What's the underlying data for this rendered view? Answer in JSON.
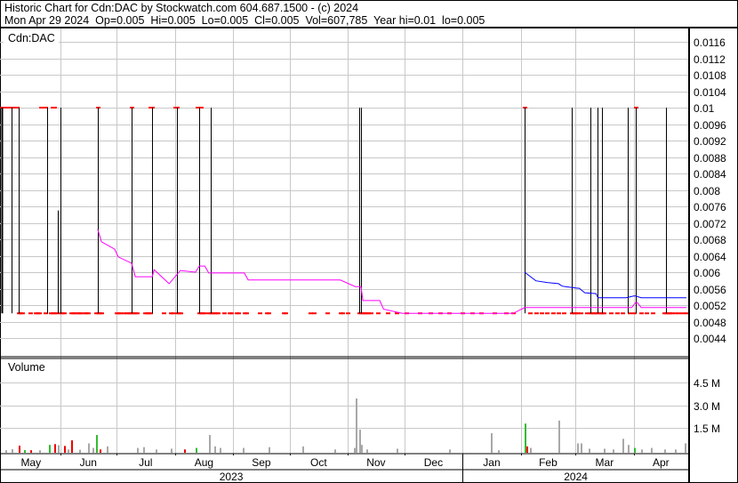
{
  "header": {
    "title": "Historic Chart for Cdn:DAC by Stockwatch.com 604.687.1500 - (c) 2024",
    "quote": "Mon Apr 29 2024  Op=0.005  Hi=0.005  Lo=0.005  Cl=0.005  Vol=607,785  Year hi=0.01  lo=0.005"
  },
  "colors": {
    "grid": "#c8c8c8",
    "bar": "#000000",
    "tick": "#ff0000",
    "ma_short": "#ff00ff",
    "ma_long": "#0000ff",
    "vol_gray": "#a8a8a8",
    "vol_up": "#33bb33",
    "vol_down": "#ee0000"
  },
  "chart_data": [
    {
      "type": "line",
      "title": "Cdn:DAC",
      "x_unit": "days since May 1 2023",
      "xlim": [
        0,
        365
      ],
      "ylim": [
        0.0042,
        0.0118
      ],
      "yticks": [
        "0.0116",
        "0.0112",
        "0.0108",
        "0.0104",
        "0.01",
        "0.0096",
        "0.0092",
        "0.0088",
        "0.0084",
        "0.008",
        "0.0076",
        "0.0072",
        "0.0068",
        "0.0064",
        "0.006",
        "0.0056",
        "0.0052",
        "0.0048",
        "0.0044"
      ],
      "grid": true,
      "hilo_bars": [
        [
          0,
          0.005,
          0.01
        ],
        [
          5,
          0.005,
          0.01
        ],
        [
          9,
          0.005,
          0.01
        ],
        [
          24,
          0.005,
          0.01
        ],
        [
          30,
          0.005,
          0.0075
        ],
        [
          31,
          0.005,
          0.01
        ],
        [
          51,
          0.005,
          0.01
        ],
        [
          69,
          0.005,
          0.01
        ],
        [
          80,
          0.005,
          0.01
        ],
        [
          93,
          0.005,
          0.01
        ],
        [
          105,
          0.005,
          0.01
        ],
        [
          111,
          0.005,
          0.01
        ],
        [
          190,
          0.005,
          0.01
        ],
        [
          191,
          0.005,
          0.01
        ],
        [
          278,
          0.005,
          0.01
        ],
        [
          303,
          0.005,
          0.01
        ],
        [
          313,
          0.005,
          0.01
        ],
        [
          317,
          0.005,
          0.01
        ],
        [
          319,
          0.005,
          0.01
        ],
        [
          333,
          0.005,
          0.01
        ],
        [
          337,
          0.005,
          0.01
        ],
        [
          353,
          0.005,
          0.01
        ]
      ],
      "ticks_high_days": [
        0,
        1,
        2,
        3,
        4,
        5,
        7,
        8,
        21,
        22,
        23,
        27,
        28,
        51,
        69,
        79,
        80,
        92,
        93,
        104,
        106,
        278,
        337
      ],
      "ticks_low_days": [
        9,
        10,
        11,
        15,
        18,
        19,
        20,
        23,
        26,
        27,
        28,
        29,
        31,
        32,
        33,
        37,
        38,
        39,
        40,
        41,
        42,
        44,
        45,
        46,
        50,
        51,
        52,
        53,
        61,
        62,
        63,
        65,
        66,
        67,
        68,
        69,
        70,
        71,
        72,
        76,
        77,
        78,
        79,
        86,
        90,
        91,
        93,
        94,
        95,
        105,
        106,
        107,
        108,
        110,
        111,
        112,
        113,
        114,
        115,
        118,
        121,
        122,
        125,
        126,
        129,
        130,
        137,
        141,
        142,
        150,
        151,
        164,
        166,
        173,
        180,
        181,
        184,
        190,
        191,
        192,
        193,
        194,
        195,
        196,
        200,
        205,
        210,
        215,
        222,
        228,
        233,
        238,
        245,
        250,
        255,
        262,
        268,
        272,
        281,
        284,
        287,
        290,
        293,
        296,
        299,
        303,
        304,
        305,
        306,
        308,
        311,
        313,
        314,
        315,
        316,
        317,
        318,
        319,
        320,
        324,
        327,
        330,
        334,
        336,
        340,
        343,
        346,
        352,
        353,
        354,
        355,
        356,
        358,
        360,
        362,
        364
      ],
      "series": [
        {
          "name": "MA short",
          "points": [
            [
              51,
              0.00704
            ],
            [
              53,
              0.00674
            ],
            [
              60,
              0.00656
            ],
            [
              62,
              0.00637
            ],
            [
              69,
              0.00622
            ],
            [
              71,
              0.00589
            ],
            [
              80,
              0.00589
            ],
            [
              81,
              0.00606
            ],
            [
              89,
              0.00572
            ],
            [
              95,
              0.00604
            ],
            [
              103,
              0.006
            ],
            [
              105,
              0.00615
            ],
            [
              108,
              0.00615
            ],
            [
              110,
              0.00598
            ],
            [
              129,
              0.00598
            ],
            [
              131,
              0.00581
            ],
            [
              180,
              0.00581
            ],
            [
              188,
              0.00565
            ],
            [
              191,
              0.00565
            ],
            [
              192,
              0.00531
            ],
            [
              201,
              0.00531
            ],
            [
              203,
              0.0051
            ],
            [
              213,
              0.005
            ],
            [
              272,
              0.005
            ],
            [
              278,
              0.00514
            ],
            [
              335,
              0.00514
            ],
            [
              337,
              0.00526
            ],
            [
              338,
              0.00526
            ],
            [
              340,
              0.00514
            ],
            [
              364,
              0.00514
            ]
          ]
        },
        {
          "name": "MA long",
          "points": [
            [
              278,
              0.006
            ],
            [
              284,
              0.00579
            ],
            [
              290,
              0.00575
            ],
            [
              296,
              0.00572
            ],
            [
              298,
              0.00566
            ],
            [
              306,
              0.00561
            ],
            [
              307,
              0.00561
            ],
            [
              310,
              0.0055
            ],
            [
              316,
              0.00548
            ],
            [
              317,
              0.00538
            ],
            [
              332,
              0.00538
            ],
            [
              336,
              0.00542
            ],
            [
              337,
              0.00542
            ],
            [
              340,
              0.00538
            ],
            [
              364,
              0.00538
            ]
          ]
        }
      ]
    },
    {
      "type": "bar",
      "title": "Volume",
      "ylim": [
        0,
        5.5
      ],
      "yticks": [
        "4.5 M",
        "3.0 M",
        "1.5 M"
      ],
      "ytick_values": [
        4.5,
        3.0,
        1.5
      ],
      "bars": [
        [
          2,
          0.05,
          "g"
        ],
        [
          5,
          0.12,
          "g"
        ],
        [
          9,
          0.35,
          "d"
        ],
        [
          12,
          0.06,
          "u"
        ],
        [
          15,
          0.05,
          "d"
        ],
        [
          20,
          0.05,
          "g"
        ],
        [
          25,
          0.4,
          "u"
        ],
        [
          28,
          0.45,
          "d"
        ],
        [
          30,
          0.38,
          "g"
        ],
        [
          33,
          0.33,
          "d"
        ],
        [
          35,
          0.1,
          "g"
        ],
        [
          37,
          0.7,
          "d"
        ],
        [
          41,
          0.08,
          "g"
        ],
        [
          46,
          0.5,
          "g"
        ],
        [
          48,
          0.2,
          "g"
        ],
        [
          50,
          1.05,
          "u"
        ],
        [
          52,
          0.1,
          "d"
        ],
        [
          56,
          0.3,
          "g"
        ],
        [
          72,
          0.2,
          "g"
        ],
        [
          75,
          0.25,
          "g"
        ],
        [
          82,
          0.1,
          "g"
        ],
        [
          90,
          0.15,
          "g"
        ],
        [
          97,
          0.1,
          "d"
        ],
        [
          103,
          0.2,
          "u"
        ],
        [
          110,
          1.05,
          "g"
        ],
        [
          113,
          0.3,
          "g"
        ],
        [
          116,
          0.2,
          "g"
        ],
        [
          128,
          0.2,
          "g"
        ],
        [
          142,
          0.25,
          "g"
        ],
        [
          160,
          0.3,
          "g"
        ],
        [
          177,
          0.1,
          "g"
        ],
        [
          187,
          0.2,
          "g"
        ],
        [
          188,
          3.45,
          "g"
        ],
        [
          190,
          1.4,
          "g"
        ],
        [
          191,
          0.4,
          "g"
        ],
        [
          194,
          0.1,
          "g"
        ],
        [
          210,
          0.15,
          "g"
        ],
        [
          238,
          0.1,
          "g"
        ],
        [
          260,
          1.17,
          "g"
        ],
        [
          264,
          0.05,
          "g"
        ],
        [
          278,
          1.8,
          "u"
        ],
        [
          279,
          0.3,
          "d"
        ],
        [
          281,
          0.2,
          "g"
        ],
        [
          296,
          2.0,
          "g"
        ],
        [
          306,
          0.5,
          "g"
        ],
        [
          308,
          0.5,
          "g"
        ],
        [
          312,
          0.15,
          "g"
        ],
        [
          320,
          0.15,
          "g"
        ],
        [
          325,
          0.1,
          "g"
        ],
        [
          330,
          0.8,
          "g"
        ],
        [
          333,
          0.4,
          "g"
        ],
        [
          336,
          0.2,
          "u"
        ],
        [
          340,
          0.1,
          "g"
        ],
        [
          345,
          0.2,
          "g"
        ],
        [
          352,
          0.1,
          "g"
        ],
        [
          358,
          0.1,
          "g"
        ],
        [
          363,
          0.5,
          "g"
        ]
      ]
    }
  ],
  "x_axis": {
    "months": [
      "May",
      "Jun",
      "Jul",
      "Aug",
      "Sep",
      "Oct",
      "Nov",
      "Dec",
      "Jan",
      "Feb",
      "Mar",
      "Apr"
    ],
    "month_start_days": [
      0,
      31,
      61,
      92,
      123,
      153,
      184,
      214,
      245,
      276,
      305,
      336
    ],
    "years": [
      "2023",
      "2024"
    ]
  }
}
